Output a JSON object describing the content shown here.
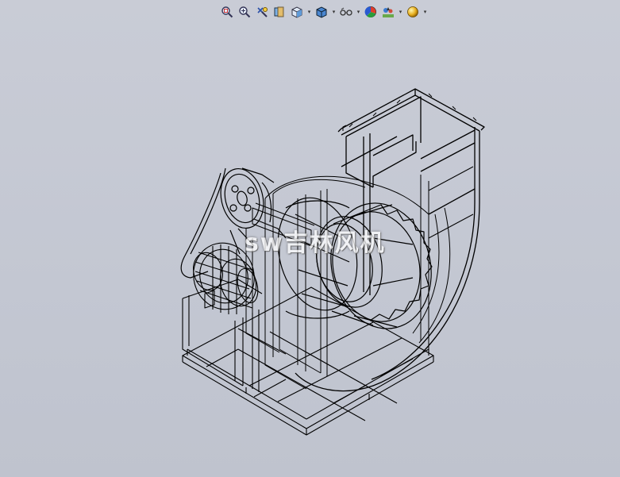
{
  "window": {
    "background": "#c5c9d3"
  },
  "toolbar": {
    "buttons": [
      {
        "name": "zoom-to-fit-icon",
        "has_dropdown": false
      },
      {
        "name": "zoom-to-area-icon",
        "has_dropdown": false
      },
      {
        "name": "previous-view-icon",
        "has_dropdown": false
      },
      {
        "name": "section-view-icon",
        "has_dropdown": false
      },
      {
        "name": "view-orientation-icon",
        "has_dropdown": true
      },
      {
        "name": "display-style-icon",
        "has_dropdown": true
      },
      {
        "name": "hide-show-items-icon",
        "has_dropdown": true
      },
      {
        "name": "edit-appearance-icon",
        "has_dropdown": false
      },
      {
        "name": "apply-scene-icon",
        "has_dropdown": true
      },
      {
        "name": "view-settings-icon",
        "has_dropdown": true
      }
    ]
  },
  "model": {
    "line_color": "#000000"
  },
  "watermark": {
    "text": "sw吉林风机"
  }
}
